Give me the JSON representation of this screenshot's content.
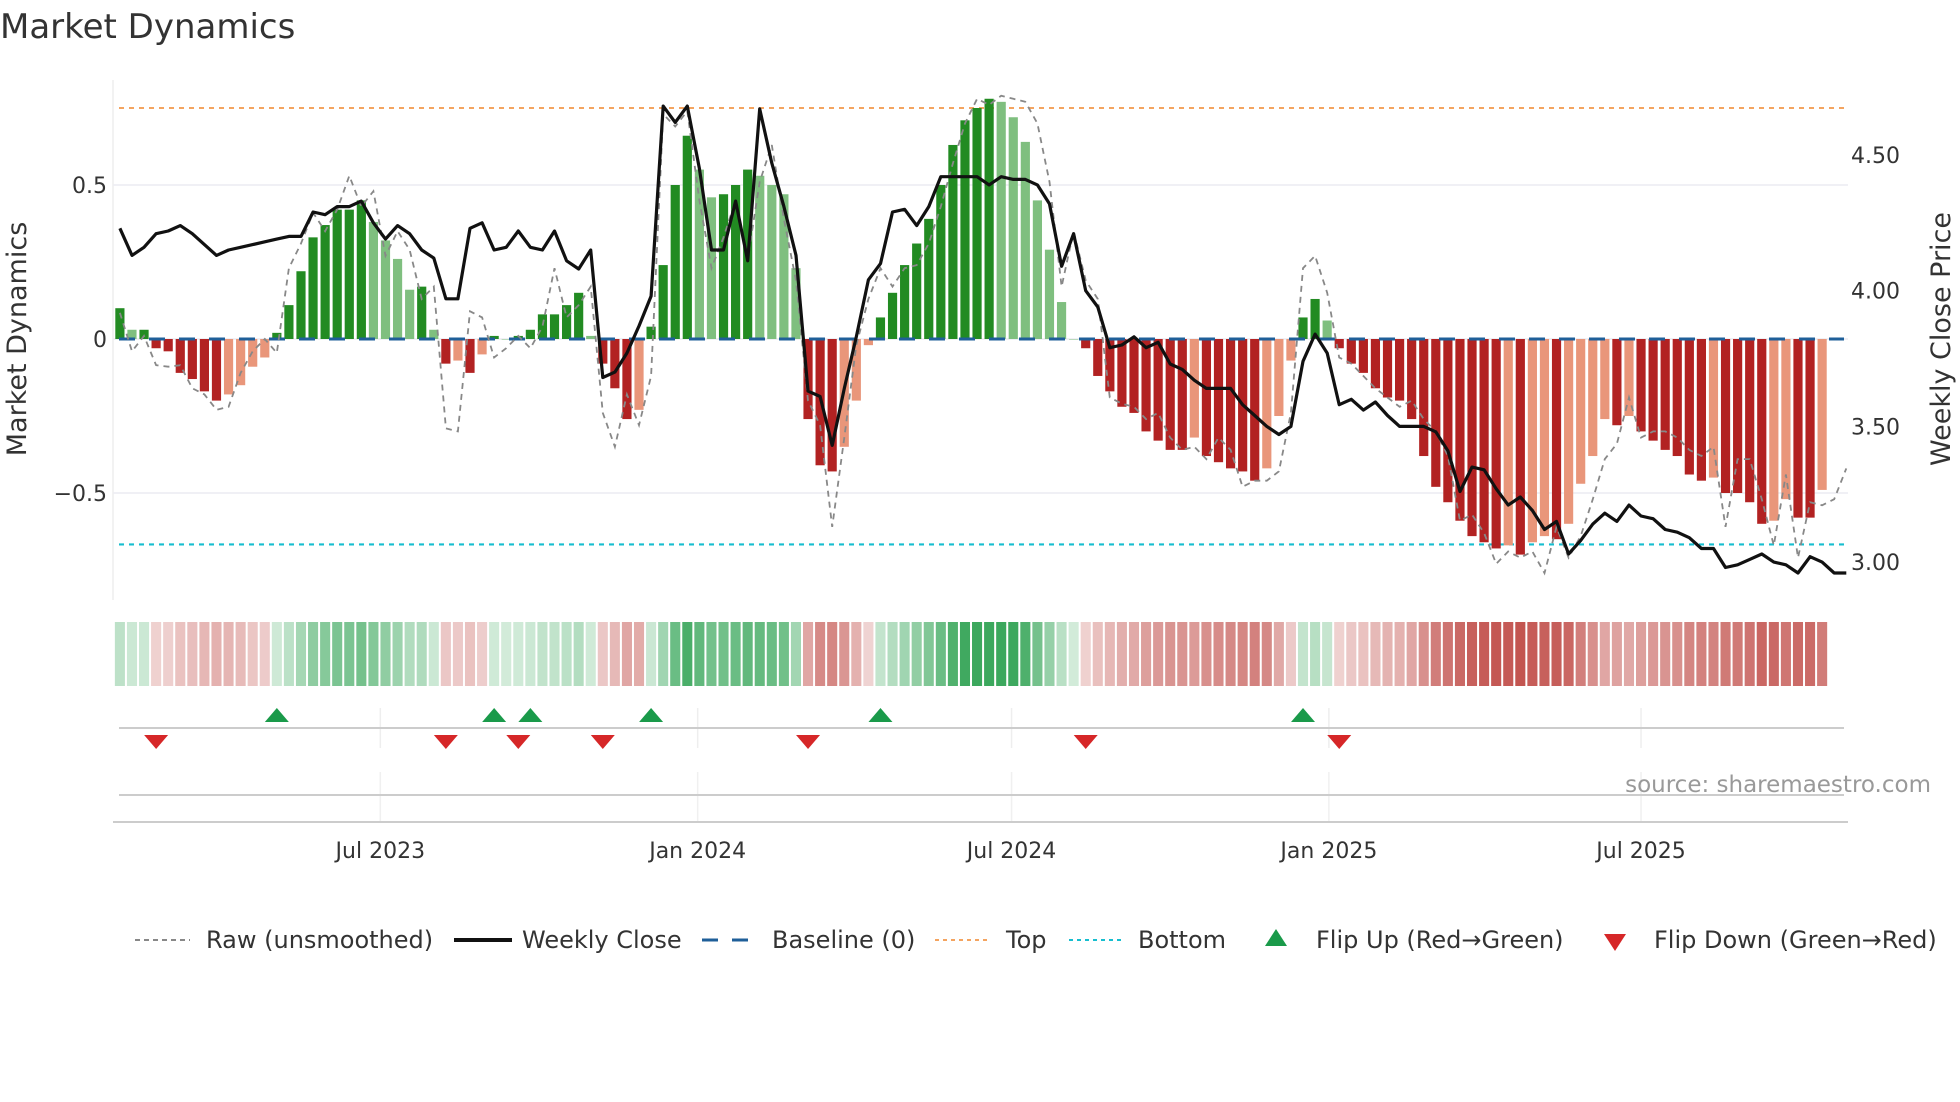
{
  "chart_data": {
    "type": "bar",
    "title": "Market Dynamics",
    "ylabel": "Market Dynamics",
    "y2label": "Weekly Close Price",
    "ylim": [
      -0.78,
      0.84
    ],
    "y2lim": [
      2.88,
      4.8
    ],
    "xlim": [
      "2023-01-27",
      "2025-10-29"
    ],
    "start_week": "2023-01-31",
    "frequency_days": 7,
    "yticks": [
      {
        "v": 0.5,
        "label": "0.5"
      },
      {
        "v": 0,
        "label": "0"
      },
      {
        "v": -0.5,
        "label": "−0.5"
      }
    ],
    "y2ticks": [
      {
        "v": 4.5,
        "label": "4.50"
      },
      {
        "v": 4.0,
        "label": "4.00"
      },
      {
        "v": 3.5,
        "label": "3.50"
      },
      {
        "v": 3.0,
        "label": "3.00"
      }
    ],
    "xticks": [
      {
        "date": "2023-07-01",
        "label": "Jul 2023"
      },
      {
        "date": "2024-01-01",
        "label": "Jan 2024"
      },
      {
        "date": "2024-07-01",
        "label": "Jul 2024"
      },
      {
        "date": "2025-01-01",
        "label": "Jan 2025"
      },
      {
        "date": "2025-07-01",
        "label": "Jul 2025"
      }
    ],
    "baseline": 0,
    "top": 0.75,
    "bottom": -0.667,
    "market_dynamics": [
      0.1,
      0.03,
      0.03,
      -0.03,
      -0.04,
      -0.11,
      -0.13,
      -0.17,
      -0.2,
      -0.18,
      -0.15,
      -0.09,
      -0.06,
      0.02,
      0.11,
      0.22,
      0.33,
      0.37,
      0.42,
      0.42,
      0.45,
      0.38,
      0.32,
      0.26,
      0.16,
      0.17,
      0.03,
      -0.08,
      -0.07,
      -0.11,
      -0.05,
      0.01,
      0.0,
      0.01,
      0.03,
      0.08,
      0.08,
      0.11,
      0.15,
      0.01,
      -0.08,
      -0.16,
      -0.26,
      -0.23,
      0.04,
      0.24,
      0.5,
      0.66,
      0.55,
      0.46,
      0.47,
      0.5,
      0.55,
      0.53,
      0.5,
      0.47,
      0.23,
      -0.26,
      -0.41,
      -0.43,
      -0.35,
      -0.2,
      -0.02,
      0.07,
      0.15,
      0.24,
      0.31,
      0.39,
      0.5,
      0.63,
      0.71,
      0.75,
      0.78,
      0.77,
      0.72,
      0.64,
      0.45,
      0.29,
      0.12,
      0.0,
      -0.03,
      -0.12,
      -0.17,
      -0.22,
      -0.24,
      -0.3,
      -0.33,
      -0.36,
      -0.36,
      -0.32,
      -0.38,
      -0.4,
      -0.42,
      -0.43,
      -0.46,
      -0.42,
      -0.25,
      -0.07,
      0.07,
      0.13,
      0.06,
      -0.03,
      -0.08,
      -0.11,
      -0.16,
      -0.19,
      -0.2,
      -0.26,
      -0.38,
      -0.48,
      -0.53,
      -0.59,
      -0.64,
      -0.66,
      -0.68,
      -0.67,
      -0.7,
      -0.66,
      -0.64,
      -0.65,
      -0.6,
      -0.47,
      -0.38,
      -0.26,
      -0.28,
      -0.25,
      -0.3,
      -0.33,
      -0.36,
      -0.38,
      -0.44,
      -0.46,
      -0.45,
      -0.5,
      -0.5,
      -0.53,
      -0.6,
      -0.59,
      -0.52,
      -0.58,
      -0.58,
      -0.49
    ],
    "raw_unsmoothed": [
      0.085,
      -0.04,
      0.01,
      -0.085,
      -0.09,
      -0.085,
      -0.16,
      -0.18,
      -0.23,
      -0.22,
      -0.11,
      -0.04,
      0.0,
      -0.045,
      0.23,
      0.31,
      0.41,
      0.35,
      0.42,
      0.53,
      0.43,
      0.48,
      0.27,
      0.35,
      0.29,
      0.13,
      0.17,
      -0.29,
      -0.3,
      0.09,
      0.07,
      -0.06,
      -0.03,
      0.01,
      -0.03,
      0.04,
      0.23,
      0.07,
      0.11,
      0.17,
      -0.24,
      -0.35,
      -0.18,
      -0.28,
      -0.12,
      0.73,
      0.69,
      0.74,
      0.45,
      0.23,
      0.33,
      0.45,
      0.26,
      0.51,
      0.63,
      0.39,
      0.19,
      -0.2,
      -0.28,
      -0.61,
      -0.32,
      -0.02,
      0.13,
      0.23,
      0.17,
      0.23,
      0.24,
      0.31,
      0.43,
      0.57,
      0.7,
      0.78,
      0.76,
      0.79,
      0.78,
      0.77,
      0.7,
      0.51,
      0.17,
      0.35,
      0.19,
      0.13,
      -0.19,
      -0.21,
      -0.22,
      -0.26,
      -0.24,
      -0.32,
      -0.36,
      -0.35,
      -0.39,
      -0.32,
      -0.36,
      -0.48,
      -0.46,
      -0.46,
      -0.43,
      -0.24,
      0.23,
      0.27,
      0.15,
      -0.06,
      -0.08,
      -0.12,
      -0.16,
      -0.19,
      -0.22,
      -0.2,
      -0.26,
      -0.3,
      -0.38,
      -0.59,
      -0.57,
      -0.63,
      -0.73,
      -0.69,
      -0.71,
      -0.69,
      -0.76,
      -0.61,
      -0.71,
      -0.64,
      -0.52,
      -0.39,
      -0.34,
      -0.19,
      -0.32,
      -0.3,
      -0.3,
      -0.32,
      -0.36,
      -0.38,
      -0.35,
      -0.61,
      -0.39,
      -0.39,
      -0.52,
      -0.67,
      -0.44,
      -0.71,
      -0.53,
      -0.54,
      -0.52,
      -0.42
    ],
    "weekly_close": [
      4.23,
      4.13,
      4.16,
      4.21,
      4.22,
      4.24,
      4.21,
      4.17,
      4.13,
      4.15,
      4.16,
      4.17,
      4.18,
      4.19,
      4.2,
      4.2,
      4.29,
      4.28,
      4.31,
      4.31,
      4.33,
      4.25,
      4.19,
      4.24,
      4.21,
      4.15,
      4.12,
      3.97,
      3.97,
      4.23,
      4.25,
      4.15,
      4.16,
      4.22,
      4.16,
      4.15,
      4.22,
      4.11,
      4.08,
      4.15,
      3.68,
      3.7,
      3.77,
      3.87,
      3.98,
      4.68,
      4.62,
      4.68,
      4.45,
      4.15,
      4.15,
      4.33,
      4.11,
      4.67,
      4.47,
      4.31,
      4.13,
      3.63,
      3.61,
      3.43,
      3.64,
      3.83,
      4.04,
      4.1,
      4.29,
      4.3,
      4.24,
      4.31,
      4.42,
      4.42,
      4.42,
      4.42,
      4.39,
      4.42,
      4.41,
      4.41,
      4.39,
      4.32,
      4.09,
      4.21,
      4.0,
      3.94,
      3.79,
      3.8,
      3.83,
      3.79,
      3.81,
      3.73,
      3.71,
      3.67,
      3.64,
      3.64,
      3.64,
      3.58,
      3.54,
      3.5,
      3.47,
      3.5,
      3.74,
      3.84,
      3.77,
      3.58,
      3.6,
      3.56,
      3.59,
      3.54,
      3.5,
      3.5,
      3.5,
      3.48,
      3.41,
      3.26,
      3.35,
      3.34,
      3.27,
      3.21,
      3.24,
      3.19,
      3.12,
      3.15,
      3.03,
      3.08,
      3.14,
      3.18,
      3.15,
      3.21,
      3.17,
      3.16,
      3.12,
      3.11,
      3.09,
      3.05,
      3.05,
      2.98,
      2.99,
      3.01,
      3.03,
      3.0,
      2.99,
      2.96,
      3.02,
      3.0,
      2.96,
      2.96
    ],
    "flip_up_indices": [
      13,
      31,
      34,
      44,
      63,
      98
    ],
    "flip_down_indices": [
      3,
      27,
      33,
      40,
      57,
      80,
      101
    ],
    "legend": {
      "placement": "bottom",
      "raw": "Raw (unsmoothed)",
      "close": "Weekly Close",
      "baseline": "Baseline (0)",
      "top": "Top",
      "bottom": "Bottom",
      "flip_up": "Flip Up (Red→Green)",
      "flip_down": "Flip Down (Green→Red)"
    },
    "source": "source: sharemaestro.com",
    "colors": {
      "green_strong": "#228b22",
      "green_weak": "#7fbf7f",
      "red_strong": "#b22222",
      "red_weak": "#e9967a",
      "baseline": "#1f5f99",
      "top": "#f4a460",
      "bottom": "#17becf",
      "flip_up": "#1a9a4a",
      "flip_down": "#d62728",
      "close": "#111111",
      "raw": "#888888"
    }
  }
}
